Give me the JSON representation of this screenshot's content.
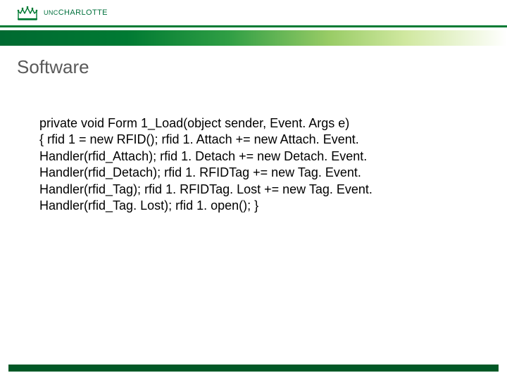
{
  "header": {
    "logo_unc": "UNC",
    "logo_charlotte": "CHARLOTTE"
  },
  "slide": {
    "title": "Software",
    "code_line1": "private void Form 1_Load(object sender, Event. Args e)",
    "code_block": "{ rfid 1 = new RFID(); rfid 1. Attach += new Attach. Event. Handler(rfid_Attach); rfid 1. Detach += new Detach. Event. Handler(rfid_Detach); rfid 1. RFIDTag += new Tag. Event. Handler(rfid_Tag); rfid 1. RFIDTag. Lost += new Tag. Event. Handler(rfid_Tag. Lost); rfid 1. open(); }"
  }
}
